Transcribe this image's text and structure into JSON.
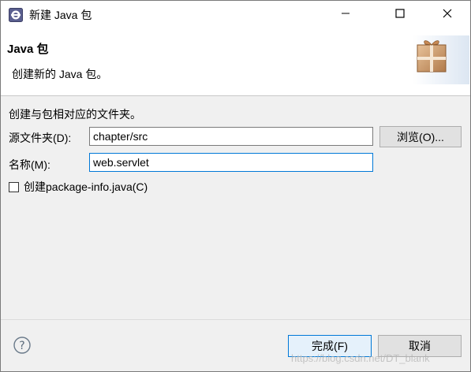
{
  "window": {
    "title": "新建 Java 包",
    "app_icon": "eclipse-icon",
    "controls": {
      "minimize_icon": "minimize-icon",
      "maximize_icon": "maximize-icon",
      "close_icon": "close-icon"
    }
  },
  "banner": {
    "title": "Java 包",
    "description": "创建新的 Java 包。",
    "graphic": "package-gift-icon"
  },
  "form": {
    "intro": "创建与包相对应的文件夹。",
    "source_folder": {
      "label": "源文件夹(D):",
      "value": "chapter/src"
    },
    "browse_button": "浏览(O)...",
    "name": {
      "label": "名称(M):",
      "value": "web.servlet"
    },
    "package_info_checkbox": {
      "label": "创建package-info.java(C)",
      "checked": false
    }
  },
  "footer": {
    "help_icon": "help-icon",
    "finish_button": "完成(F)",
    "cancel_button": "取消"
  },
  "watermark": "https://blog.csdn.net/DT_blank",
  "colors": {
    "accent": "#0078d7",
    "dialog_bg": "#f0f0f0",
    "button_bg": "#e1e1e1"
  }
}
